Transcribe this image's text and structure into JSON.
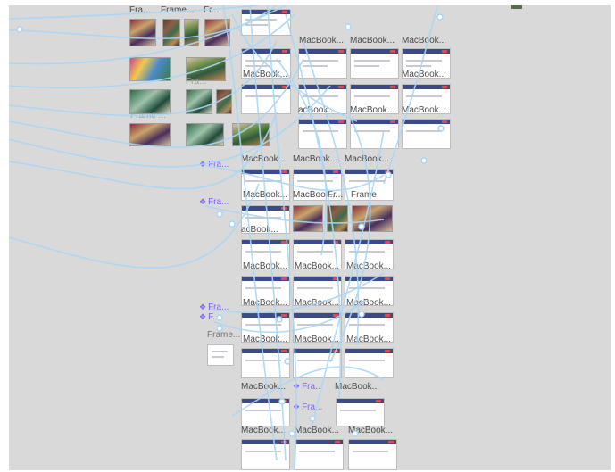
{
  "canvas": {
    "background": "#d9d9d9",
    "connector_color": "#a9d6f5",
    "frame_label_color": "#7b61ff"
  },
  "top_labels": [
    "Fra...",
    "Frame...",
    "Fr..."
  ],
  "photo_labels": [
    "Frame ...",
    "Fra...",
    "Frame..."
  ],
  "mac": "MacBook...",
  "mac_partial_left": "acBook...",
  "mac_partial_left2": "MacBook...",
  "frame_tags": {
    "fra": "Fra...",
    "fra_inline": "Fra...",
    "frame_short": "Frame...",
    "frame_gray": "Frame",
    "fra_small": "Fr...",
    "fr": "F..."
  },
  "icons": {
    "component": "component-diamond-icon"
  }
}
